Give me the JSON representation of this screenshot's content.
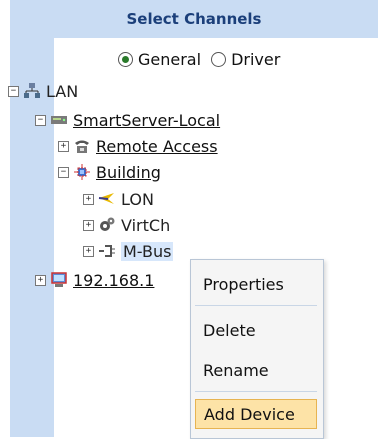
{
  "header": {
    "title": "Select Channels"
  },
  "radios": [
    {
      "label": "General",
      "checked": true
    },
    {
      "label": "Driver",
      "checked": false
    }
  ],
  "tree": {
    "lan": {
      "label": "LAN",
      "icon": "network-icon"
    },
    "smartserver": {
      "label": "SmartServer-Local",
      "icon": "server-icon"
    },
    "remote": {
      "label": "Remote Access",
      "icon": "telephone-icon"
    },
    "building": {
      "label": "Building",
      "icon": "building-icon"
    },
    "lon": {
      "label": "LON",
      "icon": "lon-icon"
    },
    "virtch": {
      "label": "VirtCh",
      "icon": "gear-icon"
    },
    "mbus": {
      "label": "M-Bus",
      "icon": "mbus-icon"
    },
    "ip": {
      "label": "192.168.1",
      "icon": "computer-icon"
    }
  },
  "context_menu": {
    "items": [
      "Properties",
      "Delete",
      "Rename",
      "Add Device"
    ],
    "active": "Add Device"
  },
  "colors": {
    "header_bg": "#c9dcf3",
    "menu_active_bg": "#fde3a7"
  }
}
